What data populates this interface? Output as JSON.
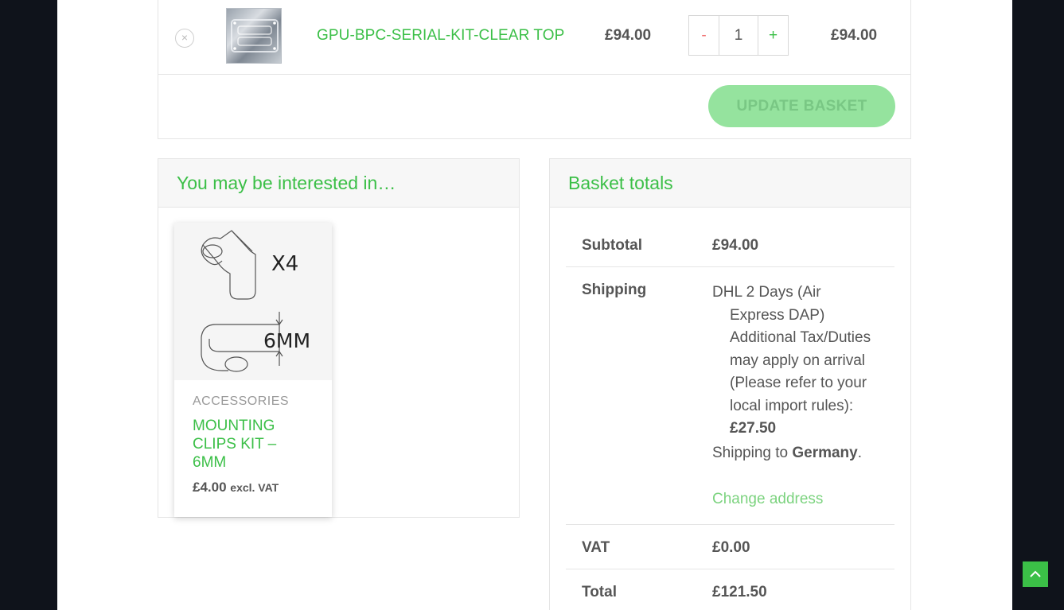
{
  "cart": {
    "remove_icon": "×",
    "product_name": "GPU-BPC-SERIAL-KIT-CLEAR TOP",
    "unit_price": "£94.00",
    "quantity": "1",
    "minus_label": "-",
    "plus_label": "+",
    "line_total": "£94.00",
    "update_label": "UPDATE BASKET"
  },
  "cross_sells": {
    "heading": "You may be interested in…",
    "product": {
      "category": "ACCESSORIES",
      "title": "MOUNTING CLIPS KIT – 6MM",
      "price": "£4.00",
      "vat_note": "excl. VAT",
      "image_labels": {
        "count": "X4",
        "size": "6MM"
      }
    }
  },
  "totals": {
    "heading": "Basket totals",
    "subtotal_label": "Subtotal",
    "subtotal_value": "£94.00",
    "shipping_label": "Shipping",
    "shipping_method_line1": "DHL 2 Days (Air",
    "shipping_method_rest": "Express DAP) Additional Tax/Duties may apply on arrival (Please refer to your local import rules):",
    "shipping_cost": "£27.50",
    "shipping_to_prefix": "Shipping to ",
    "shipping_country": "Germany",
    "shipping_to_suffix": ".",
    "change_address": "Change address",
    "vat_label": "VAT",
    "vat_value": "£0.00",
    "total_label": "Total",
    "total_value": "£121.50"
  },
  "colors": {
    "accent": "#3bbf47",
    "background": "#0f131b"
  },
  "icons": {
    "back_to_top": "chevron-up-icon",
    "remove": "close-icon"
  }
}
